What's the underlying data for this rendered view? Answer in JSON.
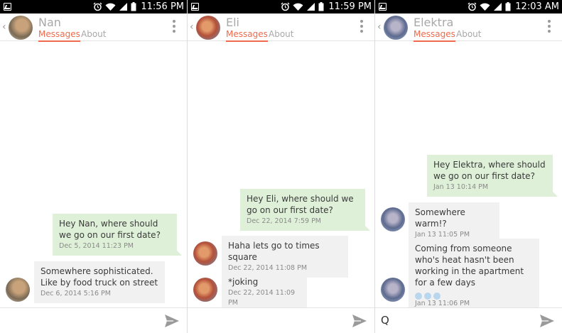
{
  "panels": [
    {
      "time": "11:56 PM",
      "contact": "Nan",
      "tabs": {
        "messages": "Messages",
        "about": "About"
      },
      "messages": [
        {
          "dir": "sent",
          "text": "Hey Nan, where should we go on our first date?",
          "meta": "Dec 5, 2014  11:23 PM"
        },
        {
          "dir": "recv",
          "text": "Somewhere sophisticated. Like by food truck on street",
          "meta": "Dec 6, 2014  5:16 PM"
        }
      ],
      "compose_value": ""
    },
    {
      "time": "11:59 PM",
      "contact": "Eli",
      "tabs": {
        "messages": "Messages",
        "about": "About"
      },
      "messages": [
        {
          "dir": "sent",
          "text": "Hey Eli, where should we go on our first date?",
          "meta": "Dec 22, 2014  7:59 PM"
        },
        {
          "dir": "recv",
          "text": "Haha lets go to times square",
          "meta": "Dec 22, 2014  11:08 PM"
        },
        {
          "dir": "recv",
          "text": "*joking",
          "meta": "Dec 22, 2014  11:09 PM"
        }
      ],
      "compose_value": ""
    },
    {
      "time": "12:03 AM",
      "contact": "Elektra",
      "tabs": {
        "messages": "Messages",
        "about": "About"
      },
      "messages": [
        {
          "dir": "sent",
          "text": "Hey Elektra, where should we go on our first date?",
          "meta": "Jan 13  10:14 PM"
        },
        {
          "dir": "recv",
          "text": "Somewhere warm!?",
          "meta": "Jan 13  11:05 PM"
        },
        {
          "dir": "recv",
          "text": "Coming from someone who's heat hasn't been working in the apartment for a few days",
          "meta": "Jan 13  11:06 PM"
        }
      ],
      "compose_value": "Q"
    }
  ],
  "icons": {
    "back": "chevron-left-icon",
    "menu": "kebab-menu-icon",
    "send": "send-icon",
    "notification": "notification-icon",
    "alarm": "alarm-icon",
    "wifi": "wifi-icon",
    "signal": "signal-icon",
    "battery": "battery-icon",
    "emoji": "snowflake-icon"
  },
  "colors": {
    "accent": "#ef6a4c",
    "sent_bubble": "#dff0d8",
    "recv_bubble": "#f1f1f1",
    "status_bar": "#000000"
  }
}
